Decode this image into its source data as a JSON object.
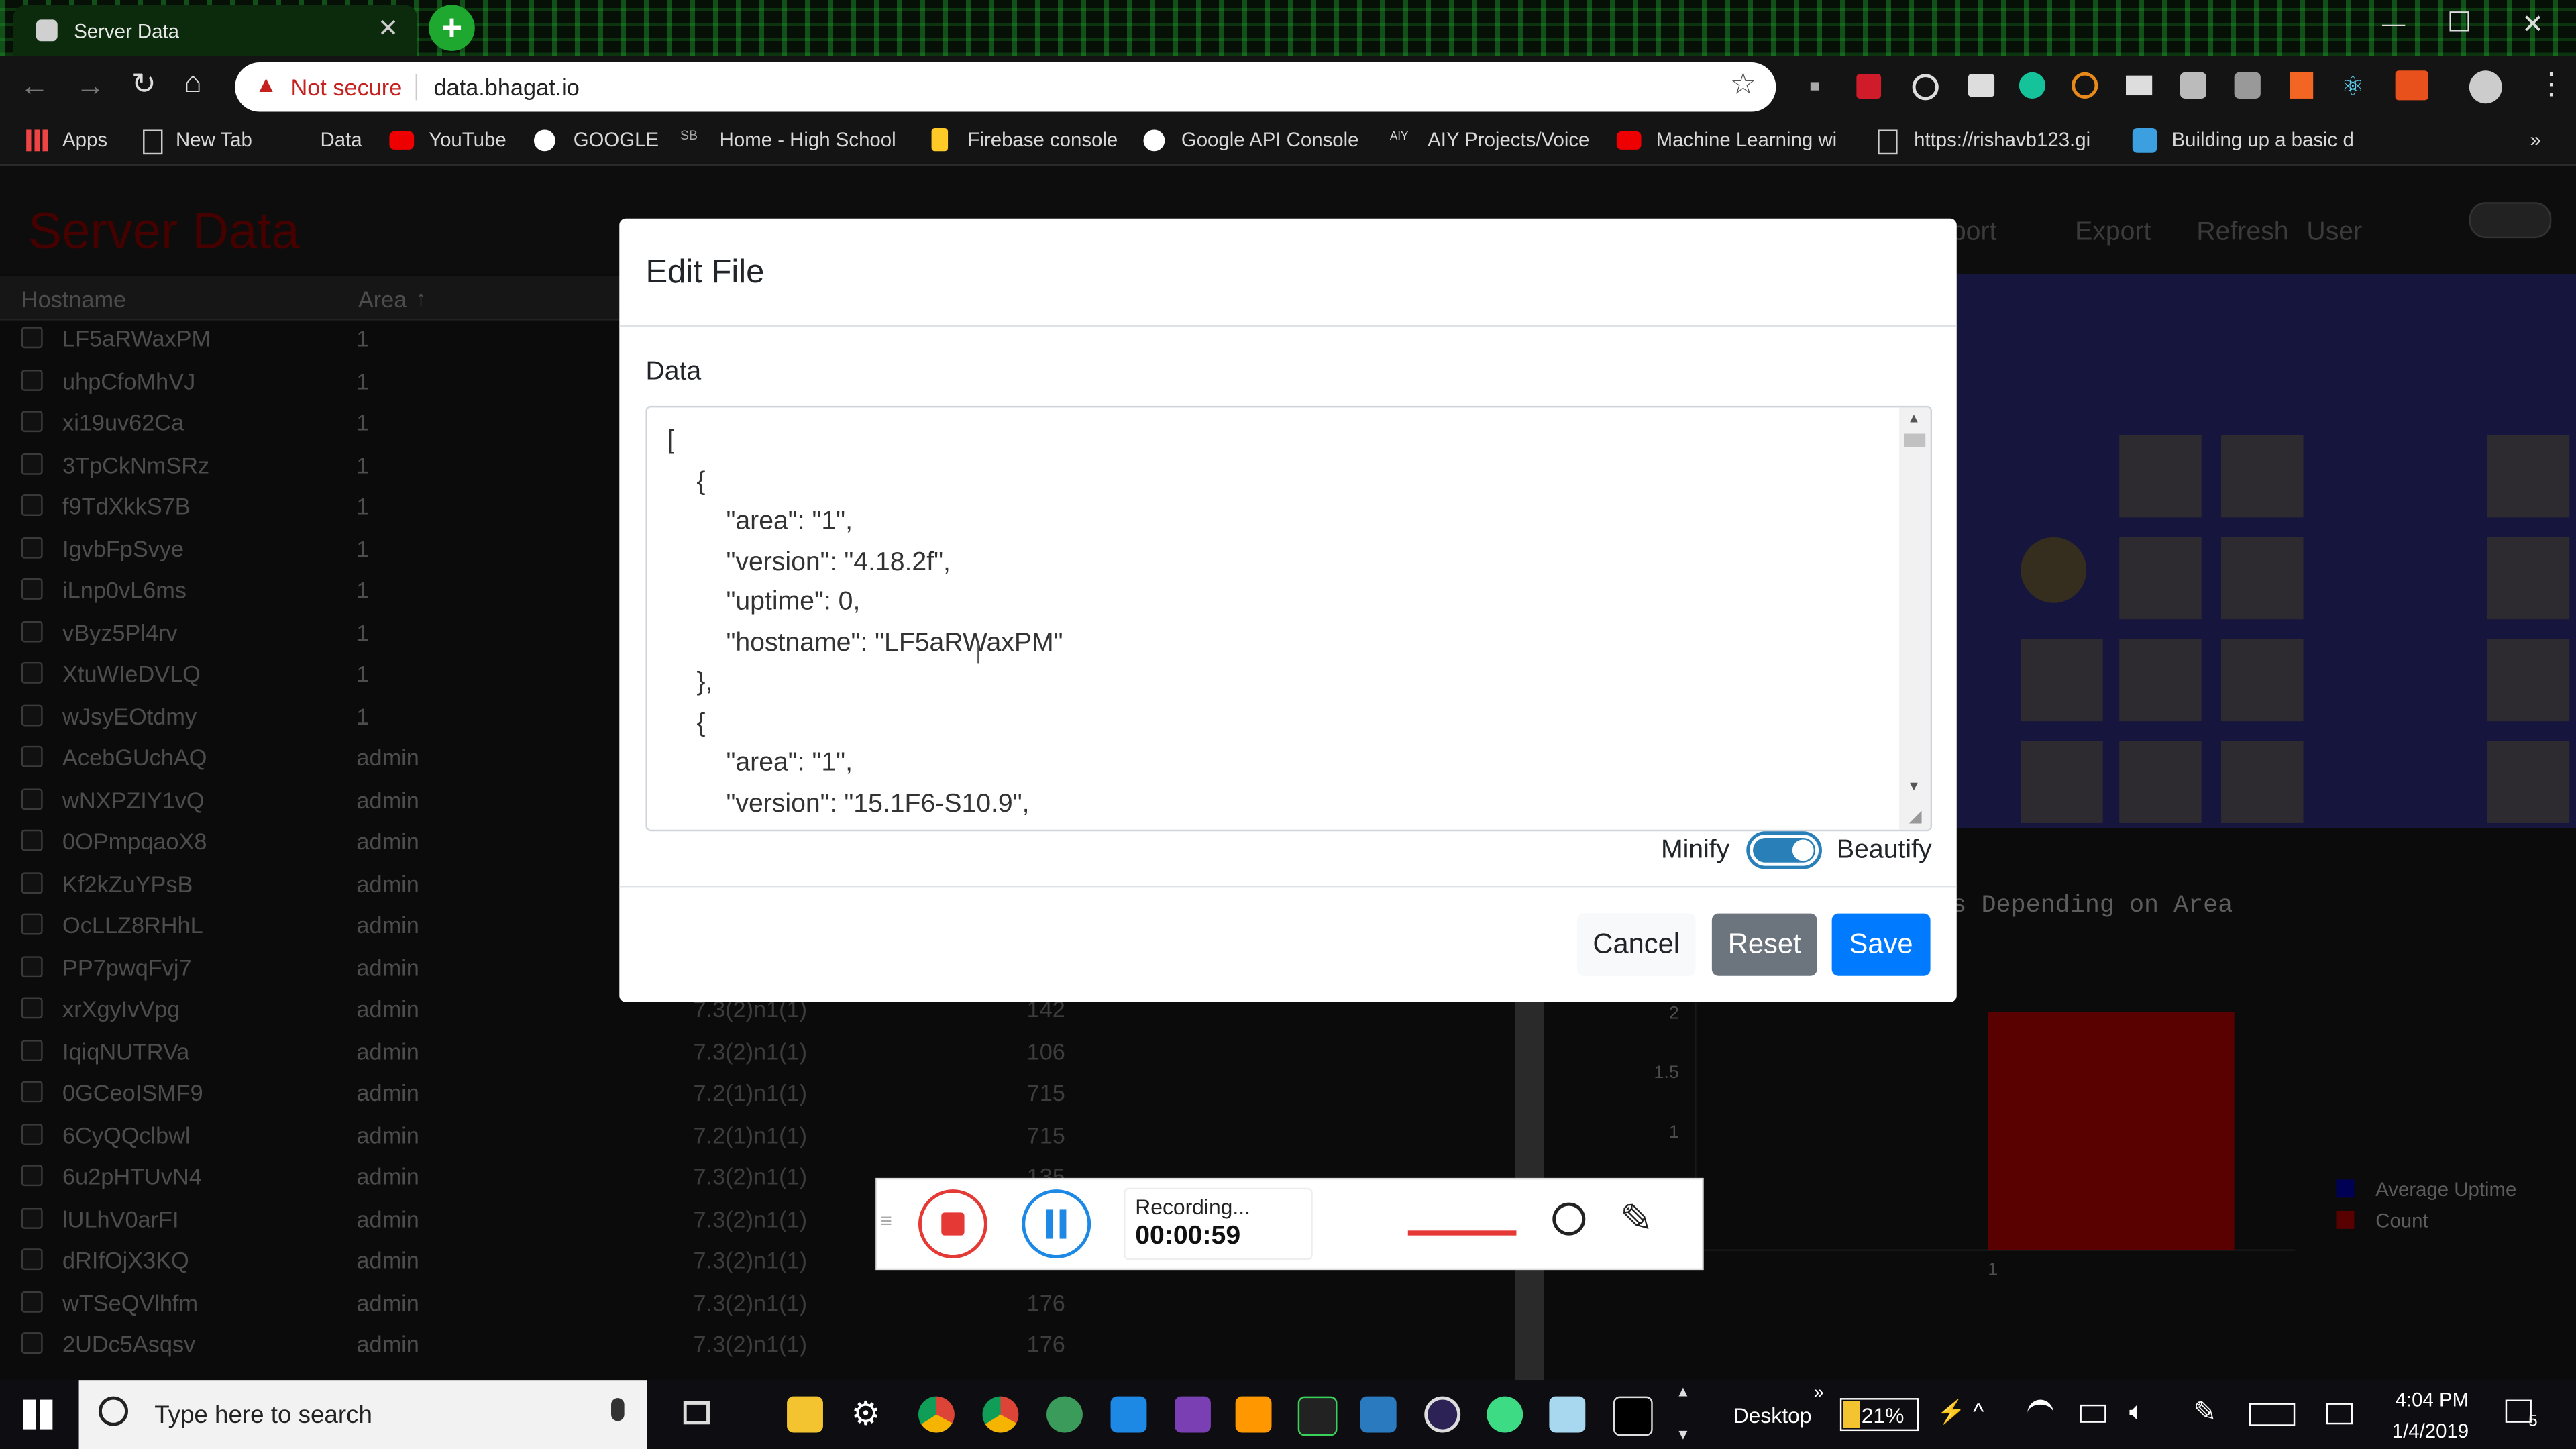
{
  "browser": {
    "tab_title": "Server Data",
    "security_label": "Not secure",
    "url": "data.bhagat.io",
    "bookmarks": [
      "Apps",
      "New Tab",
      "Data",
      "YouTube",
      "GOOGLE",
      "Home - High School",
      "Firebase console",
      "Google API Console",
      "AIY Projects/Voice",
      "Machine Learning wi",
      "https://rishavb123.gi",
      "Building up a basic d"
    ]
  },
  "app": {
    "title": "Server Data",
    "nav": [
      "Import",
      "Export",
      "Refresh",
      "User"
    ],
    "table_headers": [
      "Hostname",
      "Area"
    ],
    "rows": [
      {
        "host": "LF5aRWaxPM",
        "area": "1",
        "version": "",
        "uptime": ""
      },
      {
        "host": "uhpCfoMhVJ",
        "area": "1",
        "version": "",
        "uptime": ""
      },
      {
        "host": "xi19uv62Ca",
        "area": "1",
        "version": "",
        "uptime": ""
      },
      {
        "host": "3TpCkNmSRz",
        "area": "1",
        "version": "",
        "uptime": ""
      },
      {
        "host": "f9TdXkkS7B",
        "area": "1",
        "version": "",
        "uptime": ""
      },
      {
        "host": "IgvbFpSvye",
        "area": "1",
        "version": "",
        "uptime": ""
      },
      {
        "host": "iLnp0vL6ms",
        "area": "1",
        "version": "",
        "uptime": ""
      },
      {
        "host": "vByz5Pl4rv",
        "area": "1",
        "version": "",
        "uptime": ""
      },
      {
        "host": "XtuWIeDVLQ",
        "area": "1",
        "version": "",
        "uptime": ""
      },
      {
        "host": "wJsyEOtdmy",
        "area": "1",
        "version": "",
        "uptime": ""
      },
      {
        "host": "AcebGUchAQ",
        "area": "admin",
        "version": "",
        "uptime": ""
      },
      {
        "host": "wNXPZIY1vQ",
        "area": "admin",
        "version": "",
        "uptime": ""
      },
      {
        "host": "0OPmpqaoX8",
        "area": "admin",
        "version": "",
        "uptime": ""
      },
      {
        "host": "Kf2kZuYPsB",
        "area": "admin",
        "version": "",
        "uptime": ""
      },
      {
        "host": "OcLLZ8RHhL",
        "area": "admin",
        "version": "",
        "uptime": ""
      },
      {
        "host": "PP7pwqFvj7",
        "area": "admin",
        "version": "",
        "uptime": ""
      },
      {
        "host": "xrXgyIvVpg",
        "area": "admin",
        "version": "7.3(2)n1(1)",
        "uptime": "142"
      },
      {
        "host": "IqiqNUTRVa",
        "area": "admin",
        "version": "7.3(2)n1(1)",
        "uptime": "106"
      },
      {
        "host": "0GCeoISMF9",
        "area": "admin",
        "version": "7.2(1)n1(1)",
        "uptime": "715"
      },
      {
        "host": "6CyQQclbwl",
        "area": "admin",
        "version": "7.2(1)n1(1)",
        "uptime": "715"
      },
      {
        "host": "6u2pHTUvN4",
        "area": "admin",
        "version": "7.3(2)n1(1)",
        "uptime": "135"
      },
      {
        "host": "lULhV0arFI",
        "area": "admin",
        "version": "7.3(2)n1(1)",
        "uptime": ""
      },
      {
        "host": "dRIfOjX3KQ",
        "area": "admin",
        "version": "7.3(2)n1(1)",
        "uptime": ""
      },
      {
        "host": "wTSeQVlhfm",
        "area": "admin",
        "version": "7.3(2)n1(1)",
        "uptime": "176"
      },
      {
        "host": "2UDc5Asqsv",
        "area": "admin",
        "version": "7.3(2)n1(1)",
        "uptime": "176"
      }
    ],
    "chart_title_fragment": "s Depending on Area"
  },
  "chart_data": {
    "type": "bar",
    "title": "",
    "categories": [
      "1"
    ],
    "series": [
      {
        "name": "Average Uptime",
        "values": [
          0
        ],
        "color": "#0000aa"
      },
      {
        "name": "Count",
        "values": [
          2
        ],
        "color": "#b30000"
      }
    ],
    "y_ticks": [
      "2",
      "1.5",
      "1"
    ],
    "xlabel": "",
    "ylabel": "",
    "legend": "top-right"
  },
  "modal": {
    "title": "Edit File",
    "data_label": "Data",
    "json_lines": [
      "[",
      "{",
      "\"area\": \"1\",",
      "\"version\": \"4.18.2f\",",
      "\"uptime\": 0,",
      "\"hostname\": \"LF5aRWaxPM\"",
      "},",
      "{",
      "\"area\": \"1\",",
      "\"version\": \"15.1F6-S10.9\","
    ],
    "minify_label": "Minify",
    "beautify_label": "Beautify",
    "cancel_label": "Cancel",
    "reset_label": "Reset",
    "save_label": "Save"
  },
  "recorder": {
    "status": "Recording...",
    "time": "00:00:59"
  },
  "taskbar": {
    "search_placeholder": "Type here to search",
    "desktop_label": "Desktop",
    "battery": "21%",
    "time": "4:04 PM",
    "date": "1/4/2019",
    "notifications": "5"
  },
  "colors": {
    "accent_red": "#b30000",
    "primary_blue": "#007bff",
    "reset_grey": "#6c757d"
  }
}
